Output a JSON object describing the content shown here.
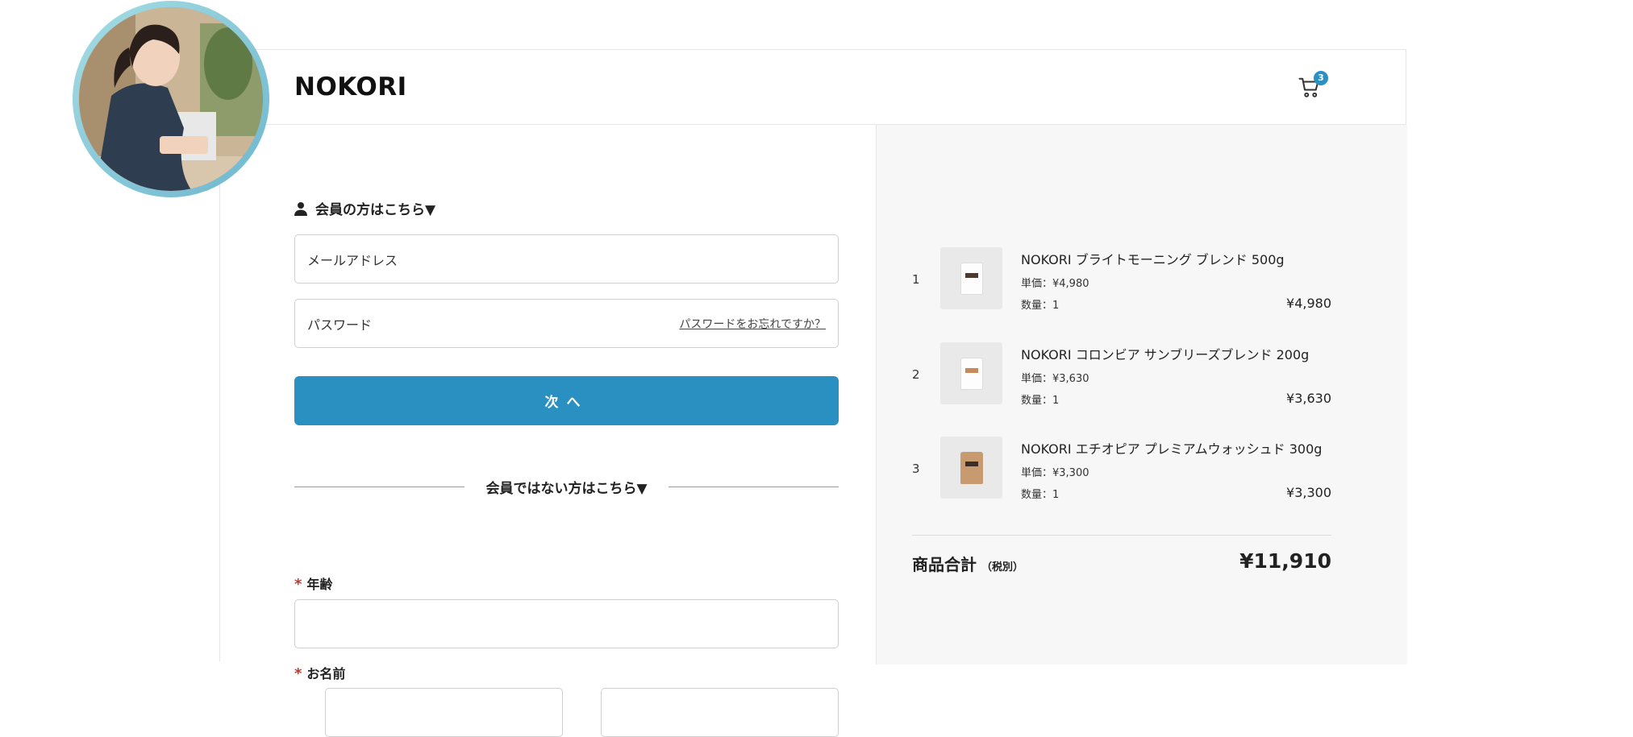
{
  "header": {
    "brand": "NOKORI",
    "cart_count": "3"
  },
  "login": {
    "title": "会員の方はこちら▼",
    "email_placeholder": "メールアドレス",
    "password_placeholder": "パスワード",
    "forgot_link": "パスワードをお忘れですか？",
    "next_button": "次へ"
  },
  "guest": {
    "title": "会員ではない方はこちら▼",
    "age_label": "年齢",
    "name_label": "お名前",
    "required_mark": "*"
  },
  "cart": {
    "items": [
      {
        "no": "1",
        "name": "NOKORI ブライトモーニング ブレンド 500g",
        "unit_price": "単価：¥4,980",
        "quantity": "数量：1",
        "price": "¥4,980"
      },
      {
        "no": "2",
        "name": "NOKORI コロンビア サンブリーズブレンド 200g",
        "unit_price": "単価：¥3,630",
        "quantity": "数量：1",
        "price": "¥3,630"
      },
      {
        "no": "3",
        "name": "NOKORI エチオピア プレミアムウォッシュド 300g",
        "unit_price": "単価：¥3,300",
        "quantity": "数量：1",
        "price": "¥3,300"
      }
    ],
    "total_label": "商品合計",
    "total_note": "（税別）",
    "total_value": "¥11,910"
  },
  "colors": {
    "accent": "#2a8fc1",
    "required": "#c0392b",
    "panel_bg": "#f7f7f7"
  }
}
